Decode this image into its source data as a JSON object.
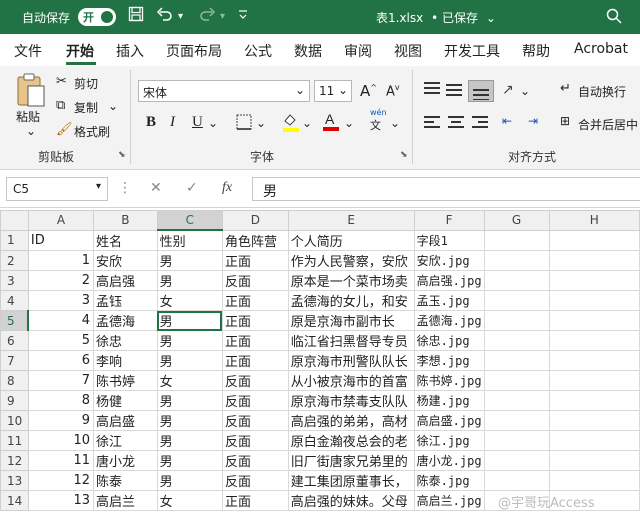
{
  "titlebar": {
    "autosave_label": "自动保存",
    "autosave_toggle": "开",
    "title": "表1.xlsx",
    "saved_status": "• 已保存",
    "accent_color": "#217346"
  },
  "tabs": [
    "文件",
    "开始",
    "插入",
    "页面布局",
    "公式",
    "数据",
    "审阅",
    "视图",
    "开发工具",
    "帮助",
    "Acrobat"
  ],
  "ribbon": {
    "paste_label": "粘贴",
    "cut_label": "剪切",
    "copy_label": "复制",
    "format_painter_label": "格式刷",
    "clipboard_group": "剪贴板",
    "font_name": "宋体",
    "font_size": "11",
    "font_group": "字体",
    "wrap_text_label": "自动换行",
    "merge_center_label": "合并后居中",
    "alignment_group": "对齐方式",
    "bold": "B",
    "italic": "I",
    "underline": "U",
    "font_increase": "A",
    "font_decrease": "A",
    "phonetic_top": "wén",
    "phonetic_bottom": "文"
  },
  "formula_bar": {
    "name_box": "C5",
    "fx_label": "fx",
    "value": "男"
  },
  "grid": {
    "columns": [
      "A",
      "B",
      "C",
      "D",
      "E",
      "F",
      "G",
      "H"
    ],
    "active_cell": "C5",
    "rows": [
      {
        "n": "1",
        "A": "ID",
        "B": "姓名",
        "C": "性别",
        "D": "角色阵营",
        "E": "个人简历",
        "F": "字段1"
      },
      {
        "n": "2",
        "A": "1",
        "B": "安欣",
        "C": "男",
        "D": "正面",
        "E": "作为人民警察，安欣",
        "F": "安欣.jpg"
      },
      {
        "n": "3",
        "A": "2",
        "B": "高启强",
        "C": "男",
        "D": "反面",
        "E": "原本是一个菜市场卖",
        "F": "高启强.jpg"
      },
      {
        "n": "4",
        "A": "3",
        "B": "孟钰",
        "C": "女",
        "D": "正面",
        "E": "孟德海的女儿，和安",
        "F": "孟玉.jpg"
      },
      {
        "n": "5",
        "A": "4",
        "B": "孟德海",
        "C": "男",
        "D": "正面",
        "E": "原是京海市副市长",
        "F": "孟德海.jpg"
      },
      {
        "n": "6",
        "A": "5",
        "B": "徐忠",
        "C": "男",
        "D": "正面",
        "E": "临江省扫黑督导专员",
        "F": "徐忠.jpg"
      },
      {
        "n": "7",
        "A": "6",
        "B": "李响",
        "C": "男",
        "D": "正面",
        "E": "原京海市刑警队队长",
        "F": "李想.jpg"
      },
      {
        "n": "8",
        "A": "7",
        "B": "陈书婷",
        "C": "女",
        "D": "反面",
        "E": "从小被京海市的首富",
        "F": "陈书婷.jpg"
      },
      {
        "n": "9",
        "A": "8",
        "B": "杨健",
        "C": "男",
        "D": "反面",
        "E": "原京海市禁毒支队队",
        "F": "杨建.jpg"
      },
      {
        "n": "10",
        "A": "9",
        "B": "高启盛",
        "C": "男",
        "D": "反面",
        "E": "高启强的弟弟，高材",
        "F": "高启盛.jpg"
      },
      {
        "n": "11",
        "A": "10",
        "B": "徐江",
        "C": "男",
        "D": "反面",
        "E": "原白金瀚夜总会的老",
        "F": "徐江.jpg"
      },
      {
        "n": "12",
        "A": "11",
        "B": "唐小龙",
        "C": "男",
        "D": "反面",
        "E": "旧厂街唐家兄弟里的",
        "F": "唐小龙.jpg"
      },
      {
        "n": "13",
        "A": "12",
        "B": "陈泰",
        "C": "男",
        "D": "反面",
        "E": "建工集团原董事长，",
        "F": "陈泰.jpg"
      },
      {
        "n": "14",
        "A": "13",
        "B": "高启兰",
        "C": "女",
        "D": "正面",
        "E": "高启强的妹妹。父母",
        "F": "高启兰.jpg"
      }
    ]
  },
  "watermark": "@宇哥玩Access"
}
